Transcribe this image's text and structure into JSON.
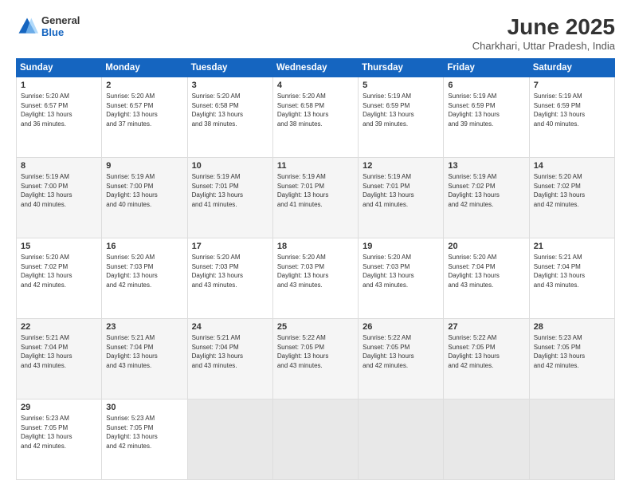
{
  "header": {
    "logo_general": "General",
    "logo_blue": "Blue",
    "month_title": "June 2025",
    "location": "Charkhari, Uttar Pradesh, India"
  },
  "weekdays": [
    "Sunday",
    "Monday",
    "Tuesday",
    "Wednesday",
    "Thursday",
    "Friday",
    "Saturday"
  ],
  "weeks": [
    [
      {
        "day": "1",
        "lines": [
          "Sunrise: 5:20 AM",
          "Sunset: 6:57 PM",
          "Daylight: 13 hours",
          "and 36 minutes."
        ]
      },
      {
        "day": "2",
        "lines": [
          "Sunrise: 5:20 AM",
          "Sunset: 6:57 PM",
          "Daylight: 13 hours",
          "and 37 minutes."
        ]
      },
      {
        "day": "3",
        "lines": [
          "Sunrise: 5:20 AM",
          "Sunset: 6:58 PM",
          "Daylight: 13 hours",
          "and 38 minutes."
        ]
      },
      {
        "day": "4",
        "lines": [
          "Sunrise: 5:20 AM",
          "Sunset: 6:58 PM",
          "Daylight: 13 hours",
          "and 38 minutes."
        ]
      },
      {
        "day": "5",
        "lines": [
          "Sunrise: 5:19 AM",
          "Sunset: 6:59 PM",
          "Daylight: 13 hours",
          "and 39 minutes."
        ]
      },
      {
        "day": "6",
        "lines": [
          "Sunrise: 5:19 AM",
          "Sunset: 6:59 PM",
          "Daylight: 13 hours",
          "and 39 minutes."
        ]
      },
      {
        "day": "7",
        "lines": [
          "Sunrise: 5:19 AM",
          "Sunset: 6:59 PM",
          "Daylight: 13 hours",
          "and 40 minutes."
        ]
      }
    ],
    [
      {
        "day": "8",
        "lines": [
          "Sunrise: 5:19 AM",
          "Sunset: 7:00 PM",
          "Daylight: 13 hours",
          "and 40 minutes."
        ]
      },
      {
        "day": "9",
        "lines": [
          "Sunrise: 5:19 AM",
          "Sunset: 7:00 PM",
          "Daylight: 13 hours",
          "and 40 minutes."
        ]
      },
      {
        "day": "10",
        "lines": [
          "Sunrise: 5:19 AM",
          "Sunset: 7:01 PM",
          "Daylight: 13 hours",
          "and 41 minutes."
        ]
      },
      {
        "day": "11",
        "lines": [
          "Sunrise: 5:19 AM",
          "Sunset: 7:01 PM",
          "Daylight: 13 hours",
          "and 41 minutes."
        ]
      },
      {
        "day": "12",
        "lines": [
          "Sunrise: 5:19 AM",
          "Sunset: 7:01 PM",
          "Daylight: 13 hours",
          "and 41 minutes."
        ]
      },
      {
        "day": "13",
        "lines": [
          "Sunrise: 5:19 AM",
          "Sunset: 7:02 PM",
          "Daylight: 13 hours",
          "and 42 minutes."
        ]
      },
      {
        "day": "14",
        "lines": [
          "Sunrise: 5:20 AM",
          "Sunset: 7:02 PM",
          "Daylight: 13 hours",
          "and 42 minutes."
        ]
      }
    ],
    [
      {
        "day": "15",
        "lines": [
          "Sunrise: 5:20 AM",
          "Sunset: 7:02 PM",
          "Daylight: 13 hours",
          "and 42 minutes."
        ]
      },
      {
        "day": "16",
        "lines": [
          "Sunrise: 5:20 AM",
          "Sunset: 7:03 PM",
          "Daylight: 13 hours",
          "and 42 minutes."
        ]
      },
      {
        "day": "17",
        "lines": [
          "Sunrise: 5:20 AM",
          "Sunset: 7:03 PM",
          "Daylight: 13 hours",
          "and 43 minutes."
        ]
      },
      {
        "day": "18",
        "lines": [
          "Sunrise: 5:20 AM",
          "Sunset: 7:03 PM",
          "Daylight: 13 hours",
          "and 43 minutes."
        ]
      },
      {
        "day": "19",
        "lines": [
          "Sunrise: 5:20 AM",
          "Sunset: 7:03 PM",
          "Daylight: 13 hours",
          "and 43 minutes."
        ]
      },
      {
        "day": "20",
        "lines": [
          "Sunrise: 5:20 AM",
          "Sunset: 7:04 PM",
          "Daylight: 13 hours",
          "and 43 minutes."
        ]
      },
      {
        "day": "21",
        "lines": [
          "Sunrise: 5:21 AM",
          "Sunset: 7:04 PM",
          "Daylight: 13 hours",
          "and 43 minutes."
        ]
      }
    ],
    [
      {
        "day": "22",
        "lines": [
          "Sunrise: 5:21 AM",
          "Sunset: 7:04 PM",
          "Daylight: 13 hours",
          "and 43 minutes."
        ]
      },
      {
        "day": "23",
        "lines": [
          "Sunrise: 5:21 AM",
          "Sunset: 7:04 PM",
          "Daylight: 13 hours",
          "and 43 minutes."
        ]
      },
      {
        "day": "24",
        "lines": [
          "Sunrise: 5:21 AM",
          "Sunset: 7:04 PM",
          "Daylight: 13 hours",
          "and 43 minutes."
        ]
      },
      {
        "day": "25",
        "lines": [
          "Sunrise: 5:22 AM",
          "Sunset: 7:05 PM",
          "Daylight: 13 hours",
          "and 43 minutes."
        ]
      },
      {
        "day": "26",
        "lines": [
          "Sunrise: 5:22 AM",
          "Sunset: 7:05 PM",
          "Daylight: 13 hours",
          "and 42 minutes."
        ]
      },
      {
        "day": "27",
        "lines": [
          "Sunrise: 5:22 AM",
          "Sunset: 7:05 PM",
          "Daylight: 13 hours",
          "and 42 minutes."
        ]
      },
      {
        "day": "28",
        "lines": [
          "Sunrise: 5:23 AM",
          "Sunset: 7:05 PM",
          "Daylight: 13 hours",
          "and 42 minutes."
        ]
      }
    ],
    [
      {
        "day": "29",
        "lines": [
          "Sunrise: 5:23 AM",
          "Sunset: 7:05 PM",
          "Daylight: 13 hours",
          "and 42 minutes."
        ]
      },
      {
        "day": "30",
        "lines": [
          "Sunrise: 5:23 AM",
          "Sunset: 7:05 PM",
          "Daylight: 13 hours",
          "and 42 minutes."
        ]
      },
      {
        "day": "",
        "lines": []
      },
      {
        "day": "",
        "lines": []
      },
      {
        "day": "",
        "lines": []
      },
      {
        "day": "",
        "lines": []
      },
      {
        "day": "",
        "lines": []
      }
    ]
  ]
}
